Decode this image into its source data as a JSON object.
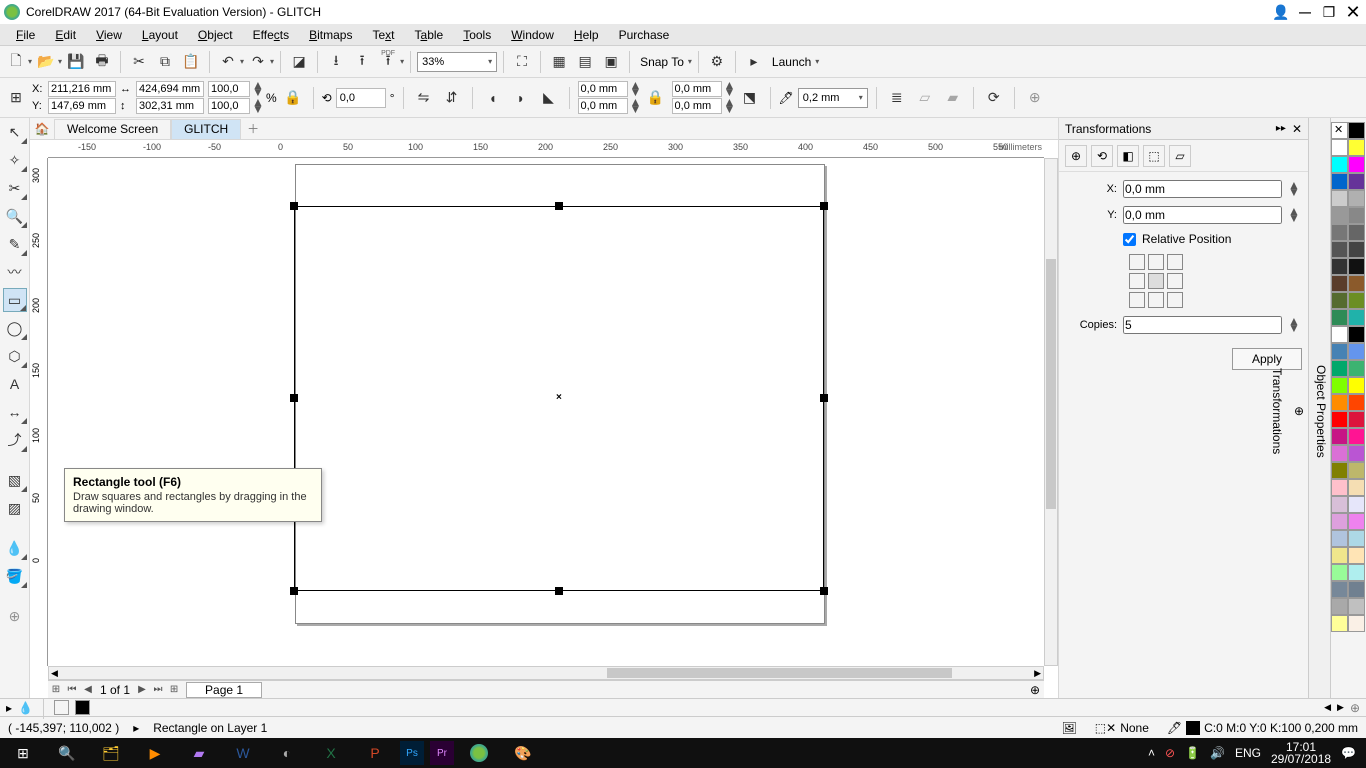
{
  "title": "CorelDRAW 2017 (64-Bit Evaluation Version) - GLITCH",
  "menu": [
    "File",
    "Edit",
    "View",
    "Layout",
    "Object",
    "Effects",
    "Bitmaps",
    "Text",
    "Table",
    "Tools",
    "Window",
    "Help",
    "Purchase"
  ],
  "menu_ul": [
    "F",
    "E",
    "V",
    "L",
    "O",
    "E",
    "B",
    "T",
    "T",
    "T",
    "W",
    "H",
    ""
  ],
  "zoom": "33%",
  "snap": "Snap To",
  "launch": "Launch",
  "propbar": {
    "x": "211,216 mm",
    "y": "147,69 mm",
    "w": "424,694 mm",
    "h": "302,31 mm",
    "sx": "100,0",
    "sy": "100,0",
    "pct": "%",
    "angle": "0,0",
    "corner1": "0,0 mm",
    "corner2": "0,0 mm",
    "corner3": "0,0 mm",
    "corner4": "0,0 mm",
    "outline": "0,2 mm"
  },
  "tabs": {
    "welcome": "Welcome Screen",
    "doc": "GLITCH"
  },
  "ruler_units": "millimeters",
  "ruler_h": [
    "-150",
    "-100",
    "-50",
    "0",
    "50",
    "100",
    "150",
    "200",
    "250",
    "300",
    "350",
    "400",
    "450",
    "500",
    "550"
  ],
  "ruler_v": [
    "300",
    "250",
    "200",
    "150",
    "100",
    "50",
    "0"
  ],
  "tooltip": {
    "title": "Rectangle tool (F6)",
    "desc": "Draw squares and rectangles by dragging in the drawing window."
  },
  "pagenav": {
    "count": "1  of  1",
    "page": "Page 1"
  },
  "docker": {
    "title": "Transformations",
    "x_lbl": "X:",
    "x_val": "0,0 mm",
    "y_lbl": "Y:",
    "y_val": "0,0 mm",
    "relpos": "Relative Position",
    "copies_lbl": "Copies:",
    "copies_val": "5",
    "apply": "Apply"
  },
  "vtabs": [
    "Object Properties",
    "Transformations"
  ],
  "status": {
    "coords": "( -145,397; 110,002 )",
    "obj": "Rectangle on Layer 1",
    "fill": "None",
    "outline": "C:0 M:0 Y:0 K:100  0,200 mm"
  },
  "tray": {
    "lang": "ENG",
    "time": "17:01",
    "date": "29/07/2018"
  },
  "palette": [
    [
      "#ffffff",
      "#ffff33"
    ],
    [
      "#00ffff",
      "#ff00ff"
    ],
    [
      "#0066cc",
      "#663399"
    ],
    [
      "#cccccc",
      "#b0b0b0"
    ],
    [
      "#999999",
      "#888888"
    ],
    [
      "#777777",
      "#666666"
    ],
    [
      "#555555",
      "#444444"
    ],
    [
      "#333333",
      "#111111"
    ],
    [
      "#5a3d2b",
      "#8b5a2b"
    ],
    [
      "#556b2f",
      "#6b8e23"
    ],
    [
      "#2e8b57",
      "#20b2aa"
    ],
    [
      "#ffffff",
      "#000000"
    ],
    [
      "#4682b4",
      "#6495ed"
    ],
    [
      "#00a86b",
      "#3cb371"
    ],
    [
      "#7fff00",
      "#ffff00"
    ],
    [
      "#ff8c00",
      "#ff4500"
    ],
    [
      "#ff0000",
      "#dc143c"
    ],
    [
      "#c71585",
      "#ff1493"
    ],
    [
      "#da70d6",
      "#ba55d3"
    ],
    [
      "#808000",
      "#bdb76b"
    ],
    [
      "#ffc0cb",
      "#f5deb3"
    ],
    [
      "#d8bfd8",
      "#e6e6fa"
    ],
    [
      "#dda0dd",
      "#ee82ee"
    ],
    [
      "#b0c4de",
      "#add8e6"
    ],
    [
      "#f0e68c",
      "#ffe4b5"
    ],
    [
      "#98fb98",
      "#afeeee"
    ],
    [
      "#778899",
      "#708090"
    ],
    [
      "#a9a9a9",
      "#c0c0c0"
    ],
    [
      "#ffff99",
      "#faf0e6"
    ]
  ]
}
